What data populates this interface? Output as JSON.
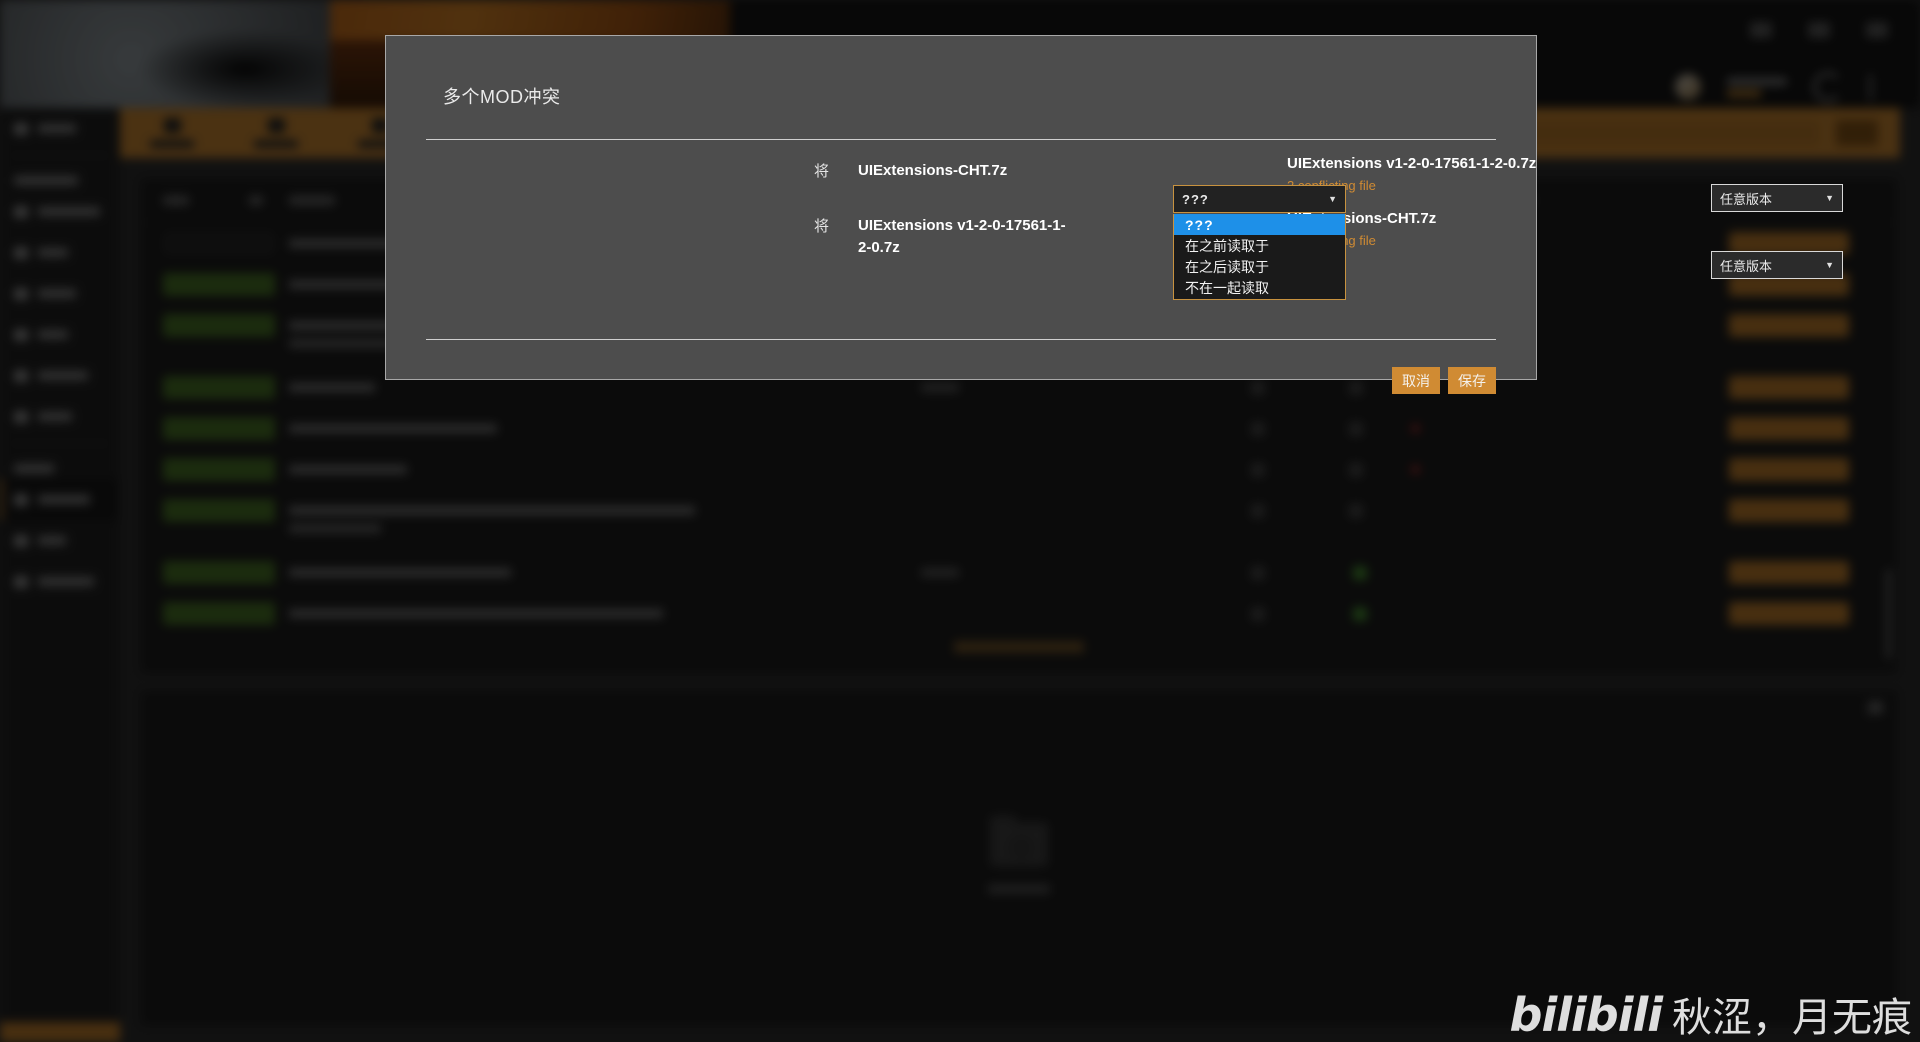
{
  "dialog": {
    "title": "多个MOD冲突",
    "prefix_label": "将",
    "rows": [
      {
        "prefix": "将",
        "left_name": "UIExtensions-CHT.7z",
        "order_value": "???",
        "right_name": "UIExtensions v1-2-0-17561-1-2-0.7z",
        "right_sub": "2 conflicting file",
        "version_value": "任意版本"
      },
      {
        "prefix": "将",
        "left_name": "UIExtensions v1-2-0-17561-1-2-0.7z",
        "order_value": "???",
        "right_name": "UIExtensions-CHT.7z",
        "right_sub": "2 conflicting file",
        "version_value": "任意版本"
      }
    ],
    "order_menu": {
      "open": true,
      "options": [
        {
          "label": "???",
          "selected": true
        },
        {
          "label": "在之前读取于",
          "selected": false
        },
        {
          "label": "在之后读取于",
          "selected": false
        },
        {
          "label": "不在一起读取",
          "selected": false
        }
      ]
    },
    "buttons": {
      "cancel": "取消",
      "save": "保存"
    },
    "caret_glyph": "▼"
  },
  "watermark": {
    "logo": "bilibili",
    "text": "秋涩，月无痕"
  },
  "colors": {
    "accent_orange": "#d08b33",
    "dialog_bg": "#4d4d4d",
    "menu_bg": "#1a1a1a",
    "highlight_blue": "#1e90e8",
    "badge_green": "#4d7a28"
  }
}
